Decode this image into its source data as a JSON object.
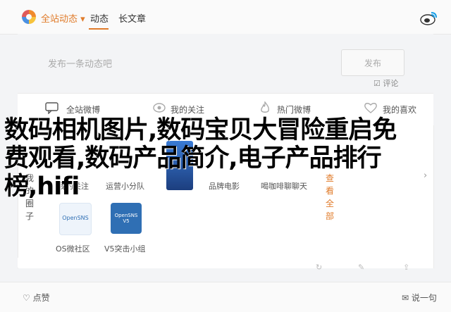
{
  "topbar": {
    "scope_dropdown": "全站动态 ▾",
    "tabs": [
      "动态",
      "长文章"
    ]
  },
  "composer": {
    "placeholder": "发布一条动态吧",
    "publish_label": "发布",
    "comment_label": "评论"
  },
  "filters": [
    {
      "label": "全站微博",
      "icon": "chat-icon"
    },
    {
      "label": "我的关注",
      "icon": "eye-icon"
    },
    {
      "label": "热门微博",
      "icon": "flame-icon"
    },
    {
      "label": "我的喜欢",
      "icon": "heart-icon"
    }
  ],
  "headline": {
    "line1": "数码相机图片,数码宝贝大冒险重启免",
    "line2": "费观看,数码产品简介,电子产品排行",
    "line3": "榜,hifi"
  },
  "sidebar": {
    "left_label": "我的圈子",
    "right_label": "查看全部",
    "follow_items": [
      "我的关注",
      "运营小分队",
      "品牌电影",
      "喝咖啡聊聊天"
    ],
    "apps": [
      {
        "name": "OS微社区",
        "tile_text": "OpenSNS"
      },
      {
        "name": "V5突击小组",
        "tile_text": "OpenSNS V5"
      }
    ]
  },
  "bottom": {
    "like_label": "点赞",
    "say_label": "说一句"
  },
  "colors": {
    "accent": "#e07b2a",
    "tile_blue": "#2f6fb4"
  }
}
